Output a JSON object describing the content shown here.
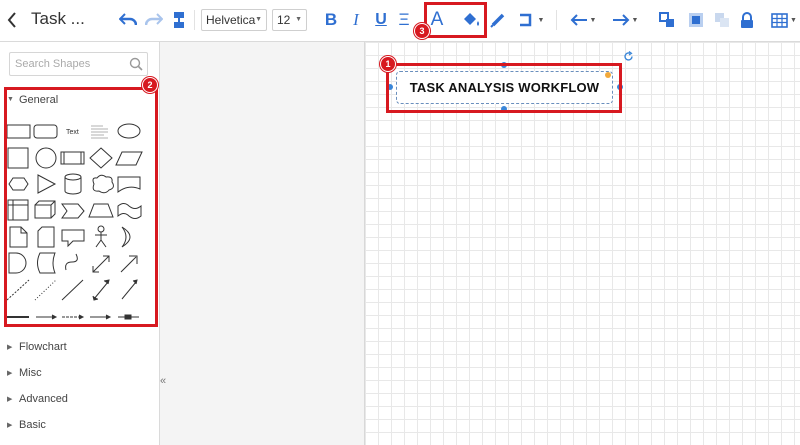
{
  "header": {
    "title": "Task ...",
    "font_family_value": "Helvetica",
    "font_size_value": "12"
  },
  "toolbar": {
    "text_color_glyph": "A",
    "bold_glyph": "B",
    "italic_glyph": "I",
    "underline_glyph": "U",
    "align_glyph": "Ξ",
    "icons": [
      "back-icon",
      "undo-icon",
      "redo-icon",
      "format-painter-icon",
      "bold-icon",
      "italic-icon",
      "underline-icon",
      "align-icon",
      "text-color-icon",
      "fill-color-icon",
      "line-color-icon",
      "connector-style-icon",
      "arrow-start-icon",
      "arrow-end-icon",
      "arrange-icon",
      "to-front-icon",
      "to-back-icon",
      "lock-icon",
      "table-icon"
    ]
  },
  "sidebar": {
    "search_placeholder": "Search Shapes",
    "sections": [
      {
        "label": "General",
        "expanded": true
      },
      {
        "label": "Flowchart",
        "expanded": false
      },
      {
        "label": "Misc",
        "expanded": false
      },
      {
        "label": "Advanced",
        "expanded": false
      },
      {
        "label": "Basic",
        "expanded": false
      }
    ],
    "shape_text_label": "Text",
    "collapse_glyph": "«"
  },
  "canvas": {
    "shape_text": "TASK ANALYSIS WORKFLOW"
  },
  "annotations": {
    "badges": [
      "1",
      "2",
      "3"
    ],
    "color": "#d71920"
  },
  "colors": {
    "accent": "#2f6fd1",
    "selection": "#3a86d8"
  }
}
